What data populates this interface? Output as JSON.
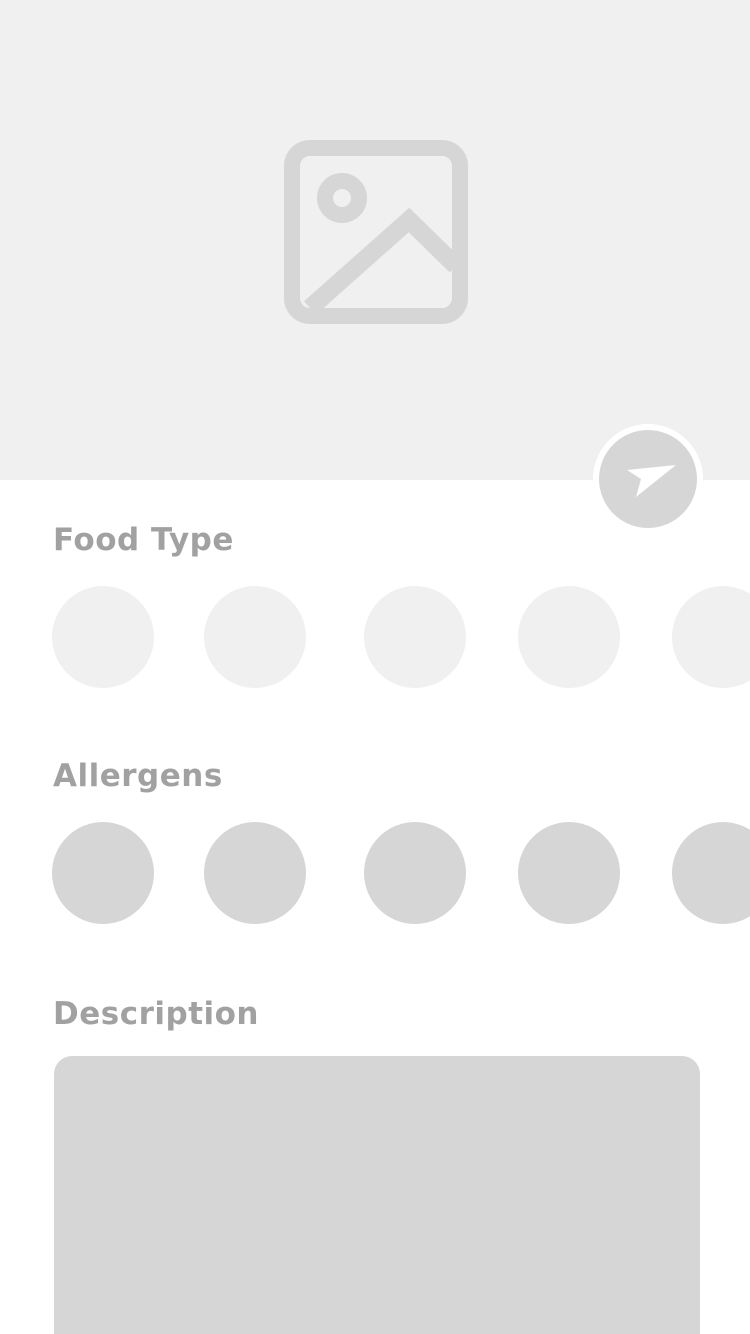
{
  "hero": {
    "icon": "image-placeholder-icon",
    "background_color": "#f0f0f0"
  },
  "send_button": {
    "icon": "paper-plane-send-icon",
    "color": "#d6d6d6"
  },
  "sections": {
    "food_type": {
      "title": "Food Type",
      "option_count_visible": 5,
      "chip_color": "#f0f0f0"
    },
    "allergens": {
      "title": "Allergens",
      "option_count_visible": 5,
      "chip_color": "#d6d6d6"
    },
    "description": {
      "title": "Description",
      "field_color": "#d6d6d6"
    }
  },
  "colors": {
    "heading_text": "#a1a1a1",
    "background": "#ffffff"
  }
}
